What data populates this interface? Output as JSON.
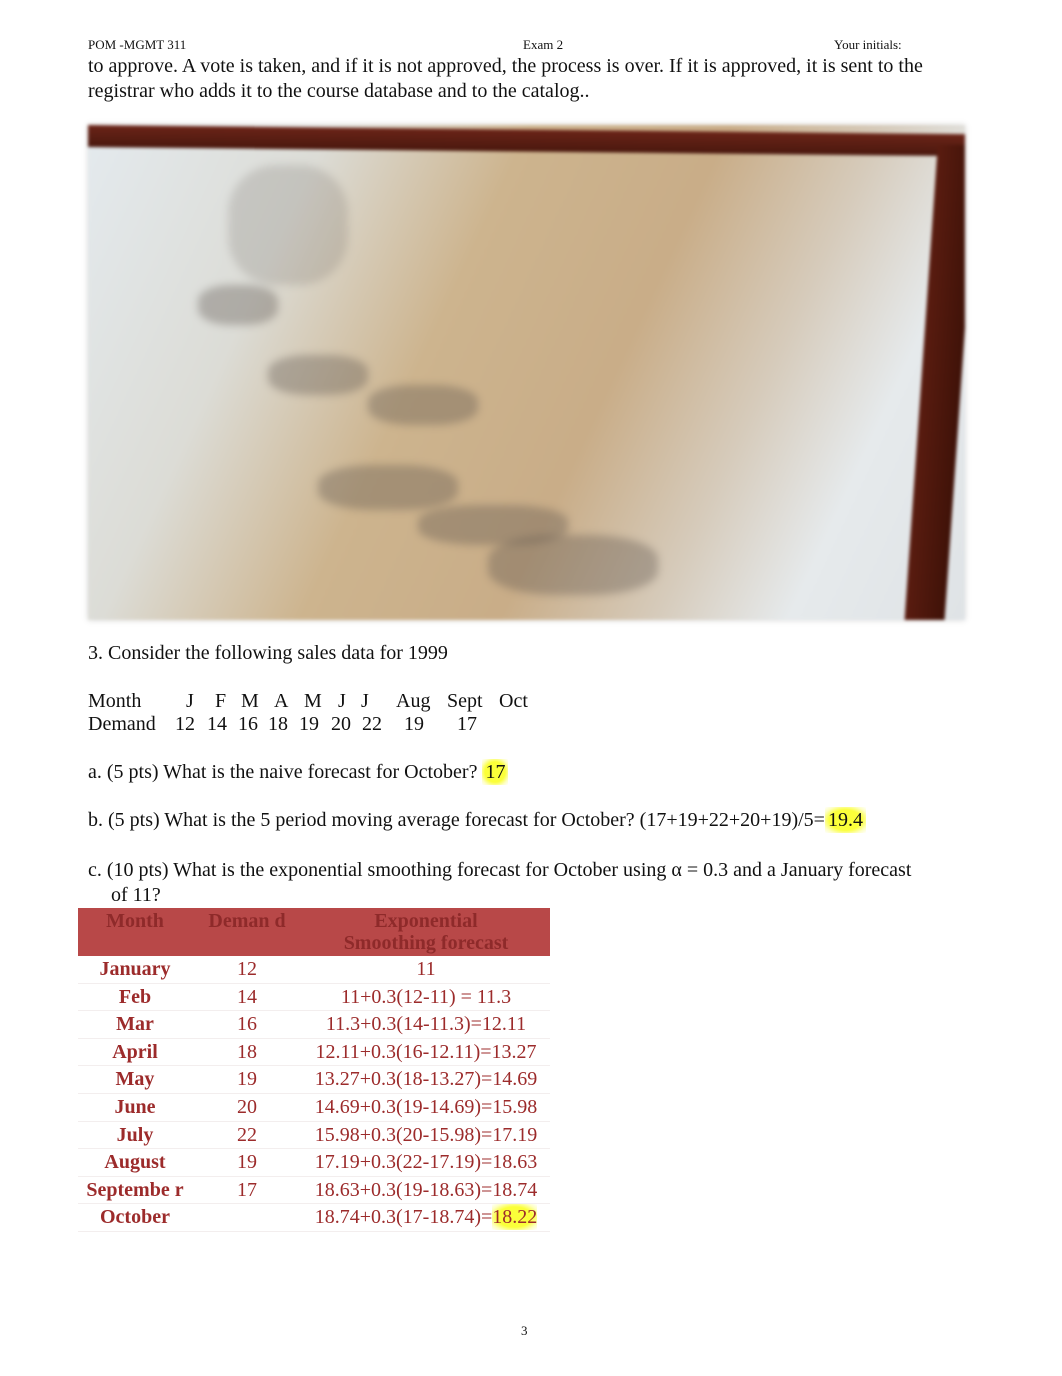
{
  "header": {
    "course": "POM -MGMT 311",
    "exam": "Exam 2",
    "initials": "Your initials:"
  },
  "intro_lines": [
    "to approve.  A vote is taken, and if it is not approved, the process is over.  If it is approved, it is sent to the",
    "registrar who adds it to the course database and to the catalog.."
  ],
  "question": "3.  Consider the following sales data for 1999",
  "sales": {
    "month_label": "Month",
    "demand_label": "Demand",
    "months": [
      "J",
      "F",
      "M",
      "A",
      "M",
      "J",
      "J",
      "Aug",
      "Sept",
      "Oct"
    ],
    "demand": [
      "12",
      "14",
      "16",
      "18",
      "19",
      "20",
      "22",
      "19",
      "17"
    ]
  },
  "part_a": {
    "text": "a.  (5 pts) What is the naive forecast for October?",
    "answer": "17"
  },
  "part_b": {
    "text": "b.  (5 pts) What is the 5 period moving average forecast for October? (17+19+22+20+19)/5=",
    "answer": "19.4"
  },
  "part_c": {
    "line1_pre": "c.  (10 pts) What is the exponential smoothing forecast for October using ",
    "alpha": "α",
    "line1_post": " = 0.3 and a January forecast",
    "line2": "of 11?"
  },
  "table": {
    "headers": [
      "Month",
      "Deman d",
      "Exponential Smoothing forecast"
    ],
    "rows": [
      {
        "month": "January",
        "demand": "12",
        "forecast": "11"
      },
      {
        "month": "Feb",
        "demand": "14",
        "forecast": "11+0.3(12-11) = 11.3"
      },
      {
        "month": "Mar",
        "demand": "16",
        "forecast": "11.3+0.3(14-11.3)=12.11"
      },
      {
        "month": "April",
        "demand": "18",
        "forecast": "12.11+0.3(16-12.11)=13.27"
      },
      {
        "month": "May",
        "demand": "19",
        "forecast": "13.27+0.3(18-13.27)=14.69"
      },
      {
        "month": "June",
        "demand": "20",
        "forecast": "14.69+0.3(19-14.69)=15.98"
      },
      {
        "month": "July",
        "demand": "22",
        "forecast": "15.98+0.3(20-15.98)=17.19"
      },
      {
        "month": "August",
        "demand": "19",
        "forecast": "17.19+0.3(22-17.19)=18.63"
      },
      {
        "month": "Septembe r",
        "demand": "17",
        "forecast": "18.63+0.3(19-18.63)=18.74"
      }
    ],
    "last_row": {
      "month": "October",
      "demand": "",
      "forecast_pre": "18.74+0.3(17-18.74)=",
      "forecast_answer": "18.22"
    }
  },
  "page_number": "3",
  "colors": {
    "table_header": "#b84848",
    "table_text": "#9c2b2b",
    "highlight": "#fbff3a"
  }
}
